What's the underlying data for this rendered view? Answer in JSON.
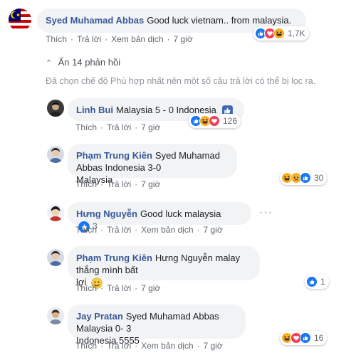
{
  "colors": {
    "author": "#385898",
    "bubble": "#f2f3f5",
    "meta": "#606770",
    "like": "#1877f2",
    "love": "#f33e58",
    "haha": "#f7b125"
  },
  "top_comment": {
    "author": "Syed Muhamad Abbas",
    "text": "Good luck vietnam.. from malaysia.",
    "actions": [
      "Thích",
      "Trả lời",
      "Xem bản dịch",
      "7 giờ"
    ],
    "reactions": {
      "icons": [
        "like-icon",
        "love-icon",
        "haha-icon"
      ],
      "count": "1,7K"
    }
  },
  "replies_toggle": {
    "label": "Ẩn 14 phản hồi"
  },
  "filter_notice": "Đã chọn chế độ Phù hợp nhất nên một số câu trả lời có thể bị lọc ra.",
  "replies": [
    {
      "author": "Linh Bui",
      "text": "Malaysia 5 - 0 Indonesia",
      "actions": [
        "Thích",
        "Trả lời",
        "7 giờ"
      ],
      "reactions": {
        "icons": [
          "like-icon",
          "haha-icon",
          "love-icon"
        ],
        "count": "126"
      }
    },
    {
      "author": "Phạm Trung Kiên",
      "line1": "Syed Muhamad Abbas Indonesia 3-0",
      "line2": "Malaysia",
      "actions": [
        "Thích",
        "Trả lời",
        "7 giờ"
      ],
      "reactions": {
        "icons": [
          "haha-icon",
          "sad-icon",
          "like-icon"
        ],
        "count": "30"
      }
    },
    {
      "author": "Hưng Nguyễn",
      "text": "Good luck malaysia",
      "actions": [
        "Thích",
        "Trả lời",
        "Xem bản dịch",
        "7 giờ"
      ],
      "reactions": {
        "icons": [
          "like-icon"
        ],
        "count": "3"
      }
    },
    {
      "author": "Phạm Trung Kiên",
      "line1": "Hưng Nguyễn malay thắng mình bất",
      "line2": "lợi",
      "actions": [
        "Thích",
        "Trả lời",
        "7 giờ"
      ],
      "reactions": {
        "icons": [
          "like-icon"
        ],
        "count": "1"
      }
    },
    {
      "author": "Jay Pratan",
      "line1": "Syed Muhamad Abbas Malaysia 0- 3",
      "line2": "Indonesia 5555",
      "actions": [
        "Thích",
        "Trả lời",
        "Xem bản dịch",
        "7 giờ"
      ],
      "reactions": {
        "icons": [
          "haha-icon",
          "love-icon",
          "like-icon"
        ],
        "count": "16"
      }
    }
  ]
}
